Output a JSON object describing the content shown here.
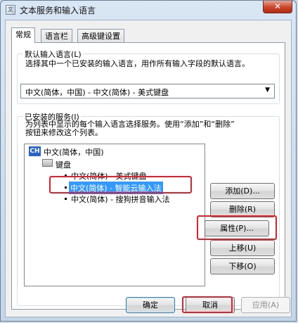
{
  "window": {
    "title": "文本服务和输入语言",
    "close_label": "✕"
  },
  "tabs": [
    {
      "label": "常规",
      "active": true
    },
    {
      "label": "语言栏",
      "active": false
    },
    {
      "label": "高级键设置",
      "active": false
    }
  ],
  "default_language": {
    "legend": "默认输入语言(L)",
    "description": "选择其中一个已安装的输入语言，用作所有输入字段的默认语言。",
    "selected": "中文(简体，中国) - 中文(简体) - 美式键盘"
  },
  "installed_services": {
    "legend": "已安装的服务(I)",
    "description_line1": "为列表中显示的每个输入语言选择服务。使用“添加”和“删除”",
    "description_line2": "按钮来修改这个列表。",
    "tree": {
      "language_badge": "CH",
      "language": "中文(简体，中国)",
      "category": "键盘",
      "items": [
        "中文(简体) - 美式键盘",
        "中文(简体) - 智能云输入法",
        "中文(简体) - 搜狗拼音输入法"
      ],
      "selected_index": 1
    }
  },
  "side_buttons": {
    "add": "添加(D)...",
    "remove": "删除(R)",
    "properties": "属性(P)...",
    "move_up": "上移(U)",
    "move_down": "下移(O)"
  },
  "footer_buttons": {
    "ok": "确定",
    "cancel": "取消",
    "apply": "应用(A)"
  },
  "colors": {
    "selection": "#3399ff",
    "highlight_box": "#e0202e"
  }
}
